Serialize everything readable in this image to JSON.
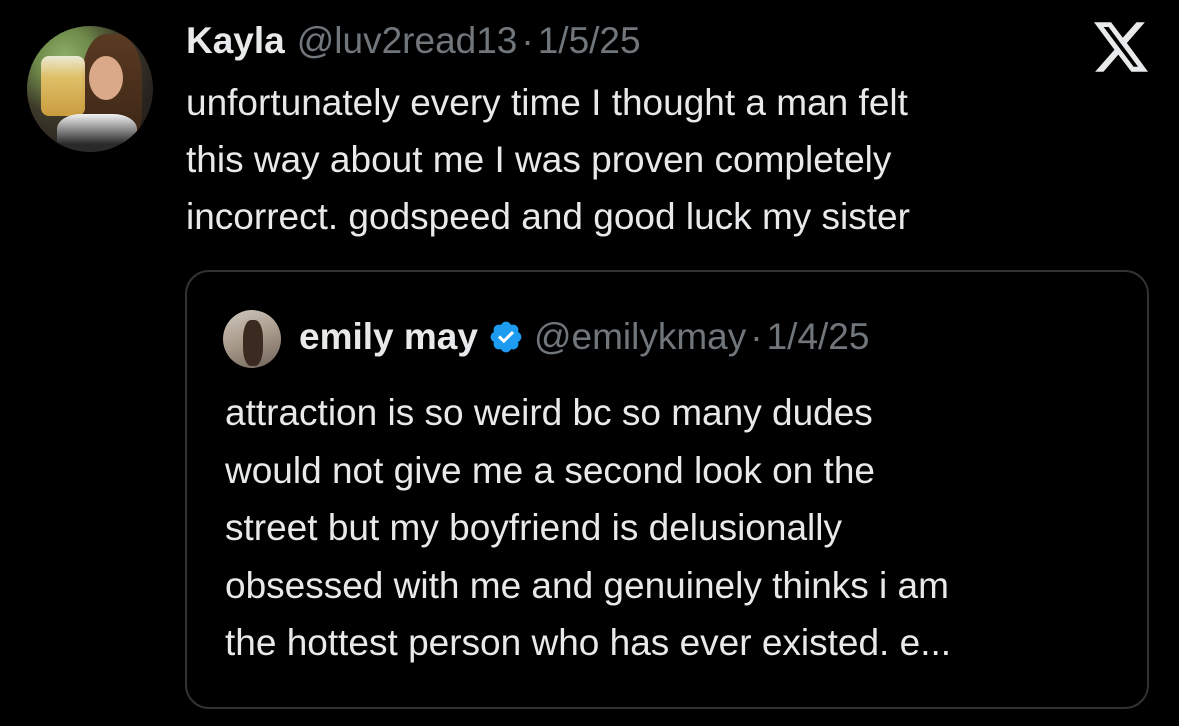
{
  "tweet": {
    "author_name": "Kayla",
    "author_handle": "@luv2read13",
    "separator": "·",
    "date": "1/5/25",
    "text_lines": [
      "unfortunately every time I thought a man felt",
      "this way about me I was proven completely",
      "incorrect. godspeed and good luck my sister"
    ],
    "avatar_icon": "profile-photo",
    "platform_icon": "x-logo-icon"
  },
  "quoted_tweet": {
    "author_name": "emily may",
    "verified": true,
    "verified_color": "#1d9bf0",
    "author_handle": "@emilykmay",
    "separator": "·",
    "date": "1/4/25",
    "text_lines": [
      "attraction is so weird bc so many dudes",
      "would not give me a second look on the",
      "street but my boyfriend is delusionally",
      "obsessed with me and genuinely thinks i am",
      "the hottest person who has ever existed. e..."
    ]
  },
  "colors": {
    "background": "#000000",
    "primary_text": "#e7e9ea",
    "secondary_text": "#71767b",
    "border": "#2f3336",
    "accent": "#1d9bf0"
  }
}
